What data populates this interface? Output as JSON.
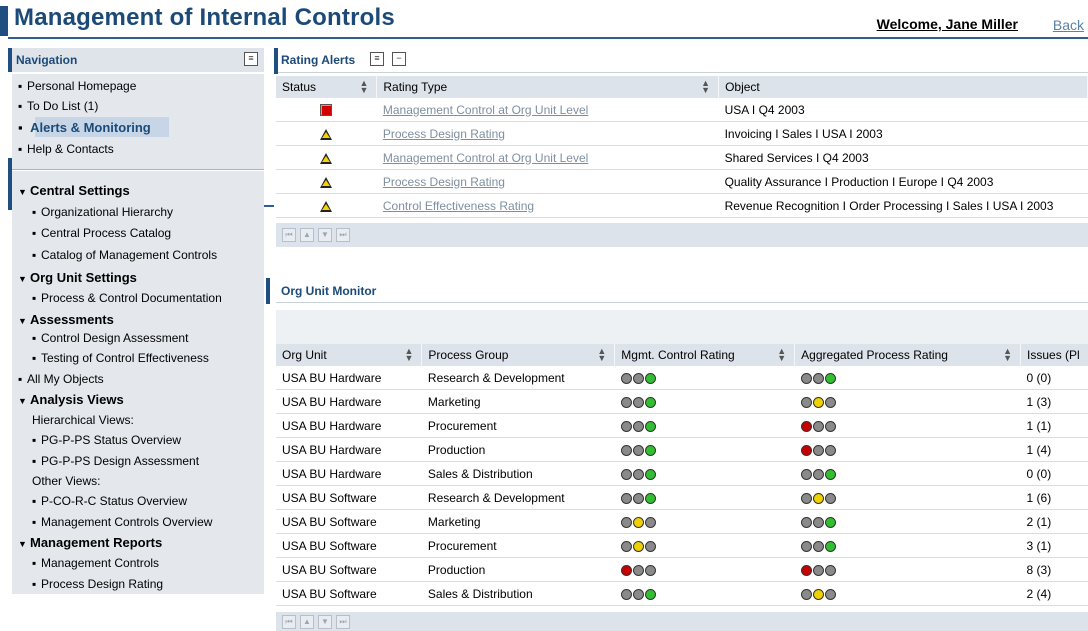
{
  "header": {
    "title": "Management of Internal Controls",
    "welcome": "Welcome, Jane Miller",
    "back": "Back"
  },
  "nav": {
    "title": "Navigation",
    "top_items": [
      "Personal Homepage",
      "To Do List (1)",
      "Alerts & Monitoring",
      "Help & Contacts"
    ],
    "active": "Alerts & Monitoring",
    "central_settings": "Central Settings",
    "central_items": [
      "Organizational Hierarchy",
      "Central Process Catalog",
      "Catalog of Management Controls"
    ],
    "org_unit_settings": "Org Unit Settings",
    "org_unit_items": [
      "Process & Control Documentation"
    ],
    "assessments": "Assessments",
    "assessment_items": [
      "Control Design Assessment",
      "Testing of Control Effectiveness"
    ],
    "all_objects": "All My Objects",
    "analysis_views": "Analysis Views",
    "hier_label": "Hierarchical Views:",
    "hier_items": [
      "PG-P-PS Status Overview",
      "PG-P-PS Design Assessment"
    ],
    "other_label": "Other Views:",
    "other_items": [
      "P-CO-R-C Status Overview",
      "Management Controls Overview"
    ],
    "mgmt_reports": "Management Reports",
    "mgmt_report_items": [
      "Management Controls",
      "Process Design Rating"
    ]
  },
  "rating_alerts": {
    "title": "Rating Alerts",
    "headers": [
      "Status",
      "Rating Type",
      "Object"
    ],
    "rows": [
      {
        "status": "red",
        "type": "Management Control at Org Unit Level",
        "object": "USA I Q4 2003"
      },
      {
        "status": "warning",
        "type": "Process Design Rating",
        "object": "Invoicing I Sales I USA I 2003"
      },
      {
        "status": "warning",
        "type": "Management Control at Org Unit Level",
        "object": "Shared Services I Q4 2003"
      },
      {
        "status": "warning",
        "type": "Process Design Rating",
        "object": "Quality Assurance I Production I Europe I Q4 2003"
      },
      {
        "status": "warning",
        "type": "Control Effectiveness Rating",
        "object": "Revenue Recognition I Order Processing I Sales I USA I 2003"
      }
    ]
  },
  "org_unit_monitor": {
    "title": "Org Unit Monitor",
    "headers": [
      "Org Unit",
      "Process Group",
      "Mgmt. Control Rating",
      "Aggregated Process Rating",
      "Issues (Pl"
    ],
    "rows": [
      {
        "org": "USA BU Hardware",
        "group": "Research & Development",
        "mgmt": "green",
        "agg": "green",
        "issues": "0 (0)"
      },
      {
        "org": "USA BU Hardware",
        "group": "Marketing",
        "mgmt": "green",
        "agg": "yellow",
        "issues": "1 (3)"
      },
      {
        "org": "USA BU Hardware",
        "group": "Procurement",
        "mgmt": "green",
        "agg": "red",
        "issues": "1 (1)"
      },
      {
        "org": "USA BU Hardware",
        "group": "Production",
        "mgmt": "green",
        "agg": "red",
        "issues": "1 (4)"
      },
      {
        "org": "USA BU Hardware",
        "group": "Sales & Distribution",
        "mgmt": "green",
        "agg": "green",
        "issues": "0 (0)"
      },
      {
        "org": "USA BU Software",
        "group": "Research & Development",
        "mgmt": "green",
        "agg": "yellow",
        "issues": "1 (6)"
      },
      {
        "org": "USA BU Software",
        "group": "Marketing",
        "mgmt": "yellow",
        "agg": "green",
        "issues": "2 (1)"
      },
      {
        "org": "USA BU Software",
        "group": "Procurement",
        "mgmt": "yellow",
        "agg": "green",
        "issues": "3 (1)"
      },
      {
        "org": "USA BU Software",
        "group": "Production",
        "mgmt": "red",
        "agg": "red",
        "issues": "8 (3)"
      },
      {
        "org": "USA BU Software",
        "group": "Sales & Distribution",
        "mgmt": "green",
        "agg": "yellow",
        "issues": "2 (4)"
      }
    ]
  },
  "colors": {
    "brand": "#1c4a78",
    "header_bg": "#dde3ea",
    "nav_bg": "#e4e8ed",
    "link": "#7f8fa0"
  }
}
